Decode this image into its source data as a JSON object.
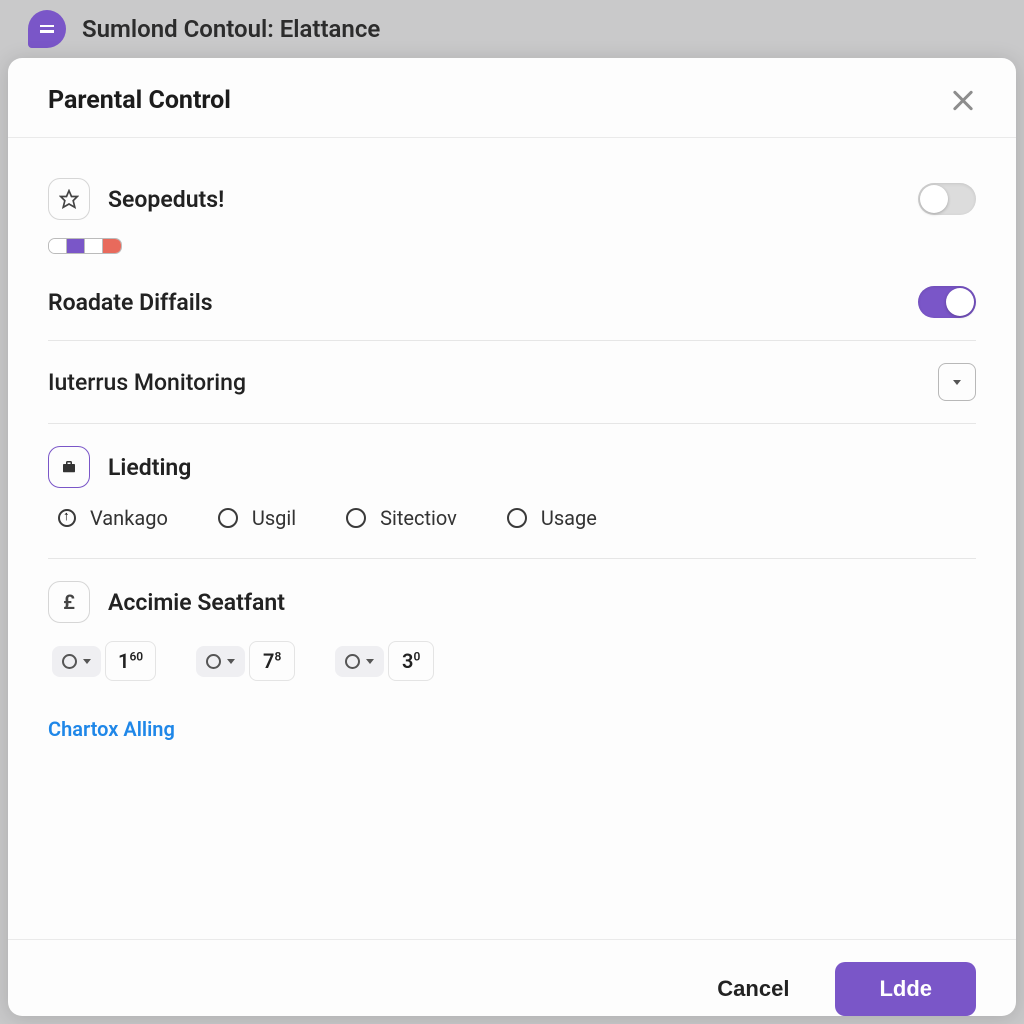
{
  "titlebar": {
    "text": "Sumlond Contoul: Elattance"
  },
  "sheet": {
    "title": "Parental Control",
    "sections": {
      "seopeduts": {
        "label": "Seopeduts!",
        "toggle": false
      },
      "roadate": {
        "label": "Roadate Diffails",
        "toggle": true
      },
      "monitoring": {
        "label": "Iuterrus Monitoring"
      },
      "liedting": {
        "label": "Liedting",
        "options": [
          "Vankago",
          "Usgil",
          "Sitectiov",
          "Usage"
        ]
      },
      "accimie": {
        "label": "Accimie Seatfant",
        "values": [
          {
            "main": "1",
            "sup": "60"
          },
          {
            "main": "7",
            "sup": "8"
          },
          {
            "main": "3",
            "sup": "0"
          }
        ]
      }
    },
    "link": "Chartox Alling",
    "footer": {
      "cancel": "Cancel",
      "primary": "Ldde"
    }
  },
  "colors": {
    "strip": [
      "#ffffff",
      "#7a56c8",
      "#ffffff",
      "#e86a5c"
    ]
  }
}
